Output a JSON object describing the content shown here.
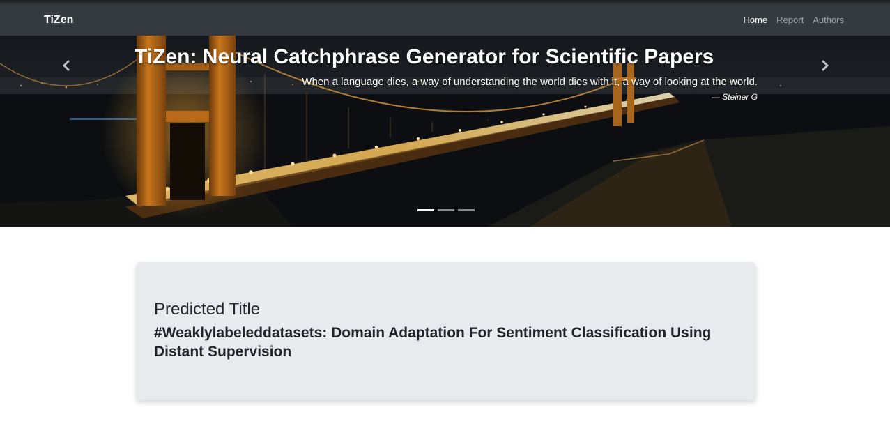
{
  "navbar": {
    "brand": "TiZen",
    "links": [
      {
        "label": "Home",
        "active": true
      },
      {
        "label": "Report",
        "active": false
      },
      {
        "label": "Authors",
        "active": false
      }
    ]
  },
  "carousel": {
    "title": "TiZen: Neural Catchphrase Generator for Scientific Papers",
    "quote": "When a language dies, a way of understanding the world dies with it, a way of looking at the world.",
    "author": "— Steiner G",
    "prev_icon": "chevron-left-icon",
    "next_icon": "chevron-right-icon",
    "slide_count": 3,
    "active_slide": 1
  },
  "result": {
    "label": "Predicted Title",
    "title": "#Weaklylabeleddatasets: Domain Adaptation For Sentiment Classification Using Distant Supervision"
  },
  "colors": {
    "navbar_bg": "#343a40",
    "card_bg": "#e9eaee",
    "text": "#212529",
    "bridge_light": "#f0a630"
  }
}
